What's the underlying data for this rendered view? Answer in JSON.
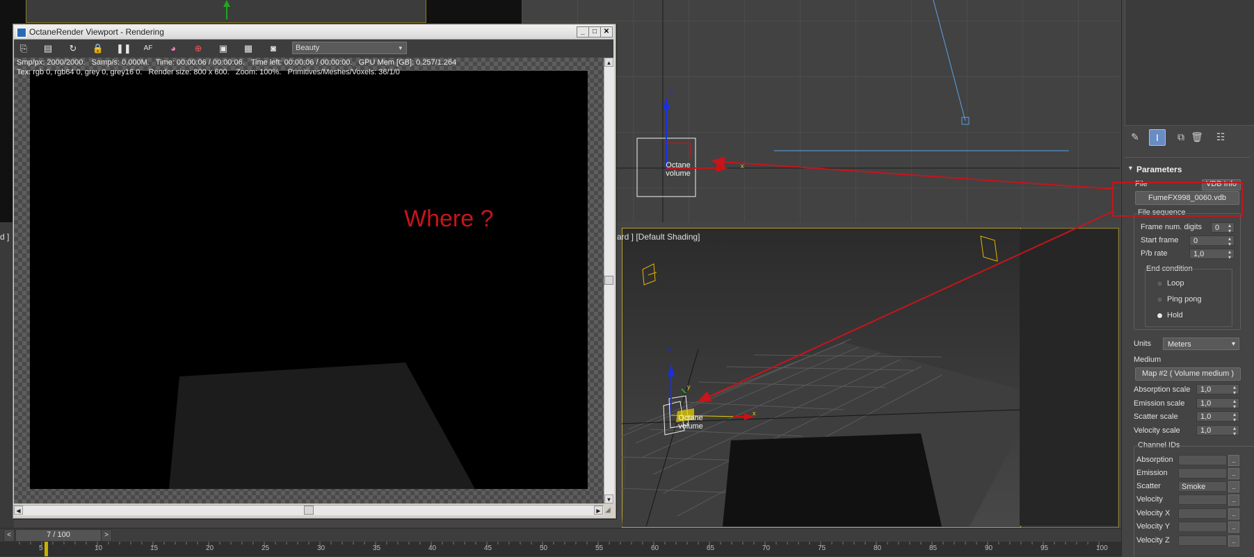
{
  "viewports": {
    "left_header": "d ]",
    "persp_header": "ard ] [Default Shading]"
  },
  "scene_labels": {
    "octane_volume_top": "Octane\nvolume",
    "octane_volume_persp": "Octane\nvolume",
    "axis_x": "x",
    "axis_z": "z",
    "axis_y": "y"
  },
  "octane_window": {
    "title": "OctaneRender Viewport - Rendering",
    "controls": {
      "minimize": "_",
      "maximize": "□",
      "close": "✕"
    },
    "toolbar_icons": [
      "open-icon",
      "save-icon",
      "restart-icon",
      "lock-icon",
      "pause-icon",
      "focus-icon",
      "color-icon",
      "region-icon",
      "display-icon",
      "film-icon",
      "camera-icon"
    ],
    "toolbar_glyphs": [
      "⎘",
      "▤",
      "↻",
      "🔒",
      "❚❚",
      "AF",
      "◕",
      "⊕",
      "▣",
      "▦",
      "◙"
    ],
    "pass_select": "Beauty",
    "info_line1": "Smp/px: 2000/2000.   Samp/s: 0.000M.   Time: 00:00:06 / 00:00:06.   Time left: 00:00:06 / 00:00:00.   GPU Mem [GB]: 0.257/1.264",
    "info_line2": "Tex: rgb 0, rgb64 0, grey 0, grey16 0.   Render size: 800 x 600.   Zoom: 100%.   Primitives/Meshes/Voxels: 36/1/0"
  },
  "annotation": {
    "text": "Where ?",
    "color": "#c8141b"
  },
  "command_panel": {
    "rollout_title": "Parameters",
    "file_label": "File",
    "vdb_info_button": "VDB Info",
    "file_button": "FumeFX998_0060.vdb",
    "file_sequence_label": "File sequence",
    "frame_num_digits": {
      "label": "Frame num. digits",
      "value": "0"
    },
    "start_frame": {
      "label": "Start frame",
      "value": "0"
    },
    "pb_rate": {
      "label": "P/b rate",
      "value": "1,0"
    },
    "end_condition": {
      "label": "End condition",
      "options": [
        "Loop",
        "Ping pong",
        "Hold"
      ],
      "selected": "Hold"
    },
    "units": {
      "label": "Units",
      "value": "Meters"
    },
    "medium": {
      "label": "Medium",
      "button": "Map #2  ( Volume medium )"
    },
    "scales": [
      {
        "label": "Absorption scale",
        "value": "1,0"
      },
      {
        "label": "Emission scale",
        "value": "1,0"
      },
      {
        "label": "Scatter scale",
        "value": "1,0"
      },
      {
        "label": "Velocity scale",
        "value": "1,0"
      }
    ],
    "channel_ids": {
      "label": "Channel IDs",
      "rows": [
        {
          "label": "Absorption",
          "value": ""
        },
        {
          "label": "Emission",
          "value": ""
        },
        {
          "label": "Scatter",
          "value": "Smoke"
        },
        {
          "label": "Velocity",
          "value": ""
        },
        {
          "label": "Velocity X",
          "value": ""
        },
        {
          "label": "Velocity Y",
          "value": ""
        },
        {
          "label": "Velocity Z",
          "value": ""
        }
      ],
      "dots": ".."
    }
  },
  "timeline": {
    "frame_display": "7 / 100",
    "prev": "<",
    "next": ">",
    "ticks": [
      "5",
      "10",
      "15",
      "20",
      "25",
      "30",
      "35",
      "40",
      "45",
      "50",
      "55",
      "60",
      "65",
      "70",
      "75",
      "80",
      "85",
      "90",
      "95",
      "100"
    ]
  }
}
